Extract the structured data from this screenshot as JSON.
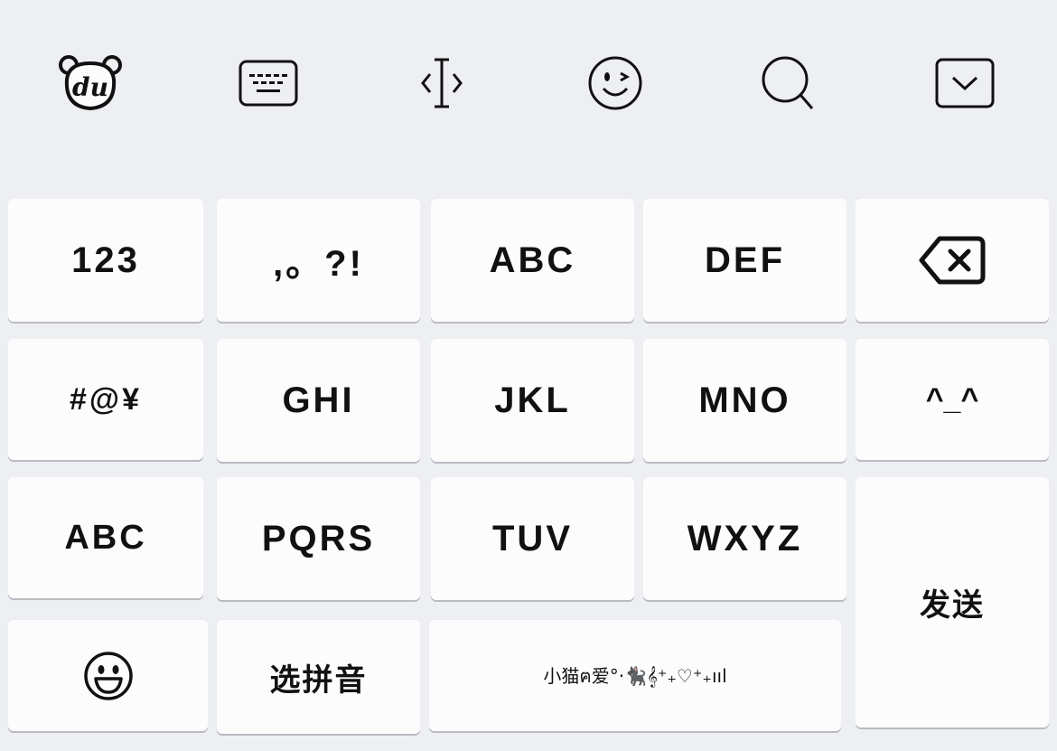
{
  "toolbar": {
    "logo_text": "du",
    "icons": [
      "bear-logo-icon",
      "keyboard-icon",
      "cursor-icon",
      "emoji-wink-icon",
      "search-icon",
      "collapse-keyboard-icon"
    ]
  },
  "keys": {
    "num": "123",
    "punct": ",。?!",
    "abc": "ABC",
    "def": "DEF",
    "symbols": "#@¥",
    "ghi": "GHI",
    "jkl": "JKL",
    "mno": "MNO",
    "kaomoji": "^_^",
    "abc_switch": "ABC",
    "pqrs": "PQRS",
    "tuv": "TUV",
    "wxyz": "WXYZ",
    "send": "发送",
    "pinyin": "选拼音",
    "space_phrase": "小猫ฅ爱°·🐈‍⬛𝄞⁺₊♡⁺₊ııl"
  },
  "colors": {
    "background": "#eeeff3",
    "key": "#fcfcfd",
    "key_shadow": "#b9bbc1",
    "icon": "#111111"
  }
}
